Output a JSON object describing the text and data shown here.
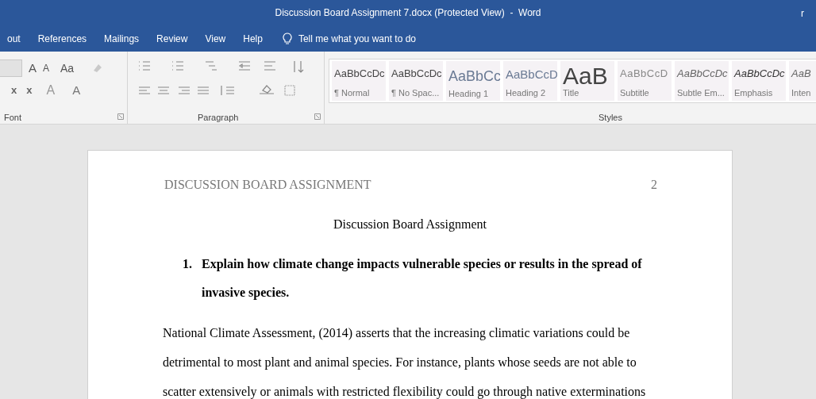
{
  "window": {
    "title": "Discussion Board Assignment 7.docx (Protected View)  -  Word",
    "user_initial": "r"
  },
  "menu_tabs": [
    {
      "label": "out"
    },
    {
      "label": "References"
    },
    {
      "label": "Mailings"
    },
    {
      "label": "Review"
    },
    {
      "label": "View"
    },
    {
      "label": "Help"
    }
  ],
  "tell_me": {
    "placeholder": "Tell me what you want to do"
  },
  "font_group": {
    "label": "Font",
    "row_1": [
      "A",
      "A",
      "Aa"
    ],
    "row_2": [
      "x",
      "x",
      "A",
      "A"
    ]
  },
  "paragraph_group": {
    "label": "Paragraph"
  },
  "styles_group": {
    "label": "Styles",
    "styles": [
      {
        "kind": "normal",
        "preview": "AaBbCcDc",
        "name": "¶ Normal"
      },
      {
        "kind": "normal",
        "preview": "AaBbCcDc",
        "name": "¶ No Spac..."
      },
      {
        "kind": "heading1",
        "preview": "AaBbCc",
        "name": "Heading 1"
      },
      {
        "kind": "heading2",
        "preview": "AaBbCcD",
        "name": "Heading 2"
      },
      {
        "kind": "title",
        "preview": "AaB",
        "name": "Title"
      },
      {
        "kind": "subtitle",
        "preview": "AaBbCcD",
        "name": "Subtitle"
      },
      {
        "kind": "italic",
        "preview": "AaBbCcDc",
        "name": "Subtle Em..."
      },
      {
        "kind": "emphasis",
        "preview": "AaBbCcDc",
        "name": "Emphasis"
      },
      {
        "kind": "italic",
        "preview": "AaB",
        "name": "Inten"
      }
    ]
  },
  "document": {
    "header": "DISCUSSION BOARD ASSIGNMENT",
    "page_number": "2",
    "title": "Discussion Board Assignment",
    "questions": [
      {
        "number": "1.",
        "lines": [
          "Explain how climate change impacts vulnerable species or results in the spread of",
          "invasive species."
        ]
      }
    ],
    "paragraph_lines": [
      "National Climate Assessment, (2014) asserts that the increasing climatic variations could be",
      "detrimental to most plant and animal species. For instance, plants whose seeds are not able to",
      "scatter extensively or animals with restricted flexibility could go through native exterminations"
    ]
  }
}
